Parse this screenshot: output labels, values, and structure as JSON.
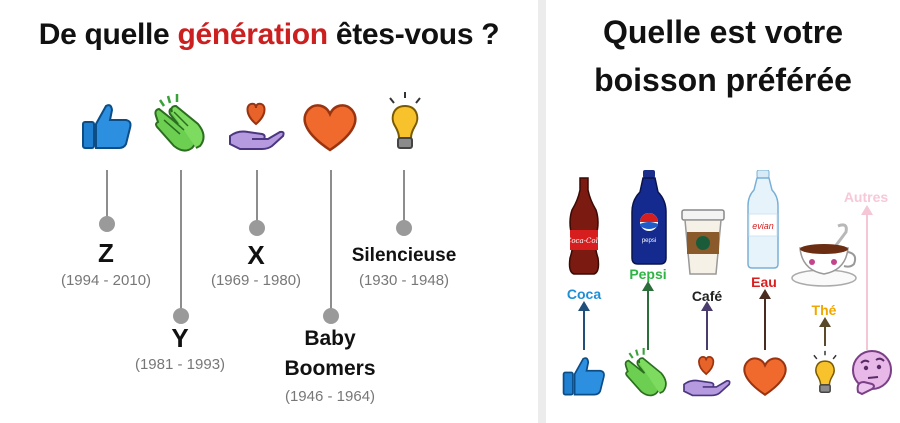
{
  "left": {
    "title_prefix": "De quelle ",
    "title_accent": "génération",
    "title_suffix": " êtes-vous ?",
    "accent_color": "#cc1f1f",
    "generations": [
      {
        "label": "Z",
        "years": "(1994 - 2010)",
        "icon": "thumbs-up-icon"
      },
      {
        "label": "Y",
        "years": "(1981 - 1993)",
        "icon": "clapping-hands-icon"
      },
      {
        "label": "X",
        "years": "(1969 - 1980)",
        "icon": "heart-in-hand-icon"
      },
      {
        "label_line1": "Baby",
        "label_line2": "Boomers",
        "years": "(1946 - 1964)",
        "icon": "heart-icon"
      },
      {
        "label": "Silencieuse",
        "years": "(1930 - 1948)",
        "icon": "light-bulb-icon"
      }
    ]
  },
  "right": {
    "title_line1": "Quelle est votre",
    "title_line2": "boisson préférée",
    "drinks": [
      {
        "label": "Coca",
        "color": "#1e8fd6",
        "icon": "thumbs-up-icon",
        "image": "coca-cola-bottle"
      },
      {
        "label": "Pepsi",
        "color": "#2fb345",
        "icon": "clapping-hands-icon",
        "image": "pepsi-bottle"
      },
      {
        "label": "Café",
        "color": "#222222",
        "icon": "heart-in-hand-icon",
        "image": "coffee-cup"
      },
      {
        "label": "Eau",
        "color": "#d81e1e",
        "icon": "heart-icon",
        "image": "evian-bottle"
      },
      {
        "label": "Thé",
        "color": "#f0a800",
        "icon": "light-bulb-icon",
        "image": "tea-cup"
      },
      {
        "label": "Autres",
        "color": "#f7c8d8",
        "icon": "thinking-face-icon",
        "image": ""
      }
    ],
    "bottle_logos": {
      "coca": "Coca-Cola",
      "pepsi": "pepsi",
      "evian": "evian"
    }
  }
}
